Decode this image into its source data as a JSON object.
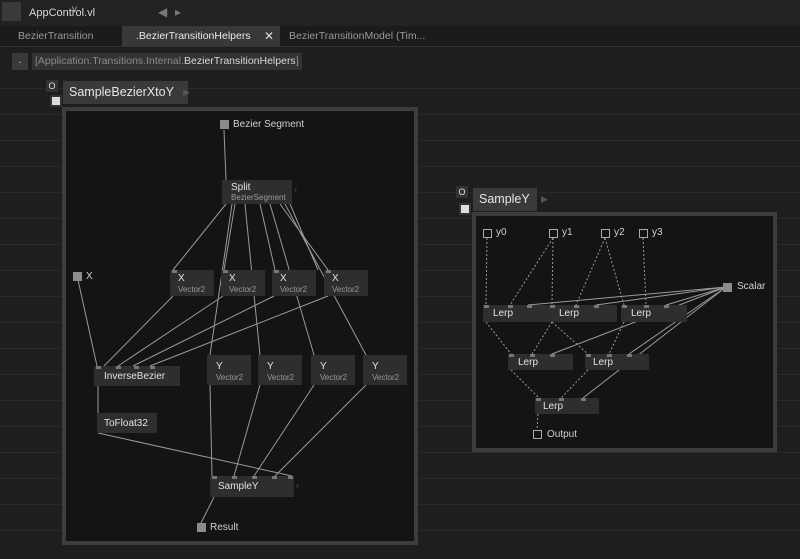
{
  "window": {
    "title": "AppControl.vl",
    "title_chevron": "v",
    "nav_back": "◀",
    "nav_forward": "▸"
  },
  "tabs": [
    {
      "label": "BezierTransition"
    },
    {
      "label": ".BezierTransitionHelpers"
    },
    {
      "label": "BezierTransitionModel (Tim..."
    }
  ],
  "tab_close": "✕",
  "path": {
    "dot": ".",
    "prefix": "[Application.Transitions.Internal.",
    "highlight": "BezierTransitionHelpers",
    "suffix": "]"
  },
  "patch1": {
    "title": "SampleBezierXtoY",
    "cat_o": "O",
    "inputs": {
      "segment": "Bezier Segment",
      "x": "X"
    },
    "output": "Result",
    "nodes": {
      "split": {
        "label": "Split",
        "sub": "BezierSegment"
      },
      "x1": {
        "label": "X",
        "sub": "Vector2"
      },
      "x2": {
        "label": "X",
        "sub": "Vector2"
      },
      "x3": {
        "label": "X",
        "sub": "Vector2"
      },
      "x4": {
        "label": "X",
        "sub": "Vector2"
      },
      "inverse": {
        "label": "InverseBezier"
      },
      "y1": {
        "label": "Y",
        "sub": "Vector2"
      },
      "y2": {
        "label": "Y",
        "sub": "Vector2"
      },
      "y3": {
        "label": "Y",
        "sub": "Vector2"
      },
      "y4": {
        "label": "Y",
        "sub": "Vector2"
      },
      "tofloat": {
        "label": "ToFloat32"
      },
      "sampley": {
        "label": "SampleY"
      }
    }
  },
  "patch2": {
    "title": "SampleY",
    "cat_o": "O",
    "inputs": {
      "y0": "y0",
      "y1": "y1",
      "y2": "y2",
      "y3": "y3",
      "scalar": "Scalar"
    },
    "output": "Output",
    "nodes": {
      "lerp1": {
        "label": "Lerp"
      },
      "lerp2": {
        "label": "Lerp"
      },
      "lerp3": {
        "label": "Lerp"
      },
      "lerp4": {
        "label": "Lerp"
      },
      "lerp5": {
        "label": "Lerp"
      },
      "lerp6": {
        "label": "Lerp"
      }
    }
  }
}
